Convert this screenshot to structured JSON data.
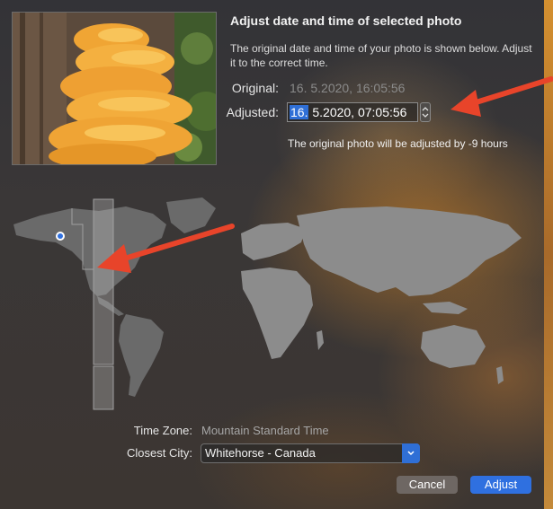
{
  "dialog": {
    "title": "Adjust date and time of selected photo",
    "description": "The original date and time of your photo is shown below. Adjust it to the correct time.",
    "original_label": "Original:",
    "original_value": "16.  5.2020, 16:05:56",
    "adjusted_label": "Adjusted:",
    "adjusted_selected": "16.",
    "adjusted_rest": "  5.2020, 07:05:56",
    "adjust_note": "The original photo will be adjusted by -9 hours"
  },
  "timezone": {
    "label": "Time Zone:",
    "value": "Mountain Standard Time"
  },
  "city": {
    "label": "Closest City:",
    "value": "Whitehorse - Canada"
  },
  "buttons": {
    "cancel": "Cancel",
    "adjust": "Adjust"
  },
  "icons": {
    "stepper": "stepper-arrows-icon",
    "dropdown": "chevron-down-icon",
    "location_dot": "location-dot-icon"
  },
  "colors": {
    "accent": "#2f70e0",
    "annotation_arrow": "#e8442a"
  }
}
